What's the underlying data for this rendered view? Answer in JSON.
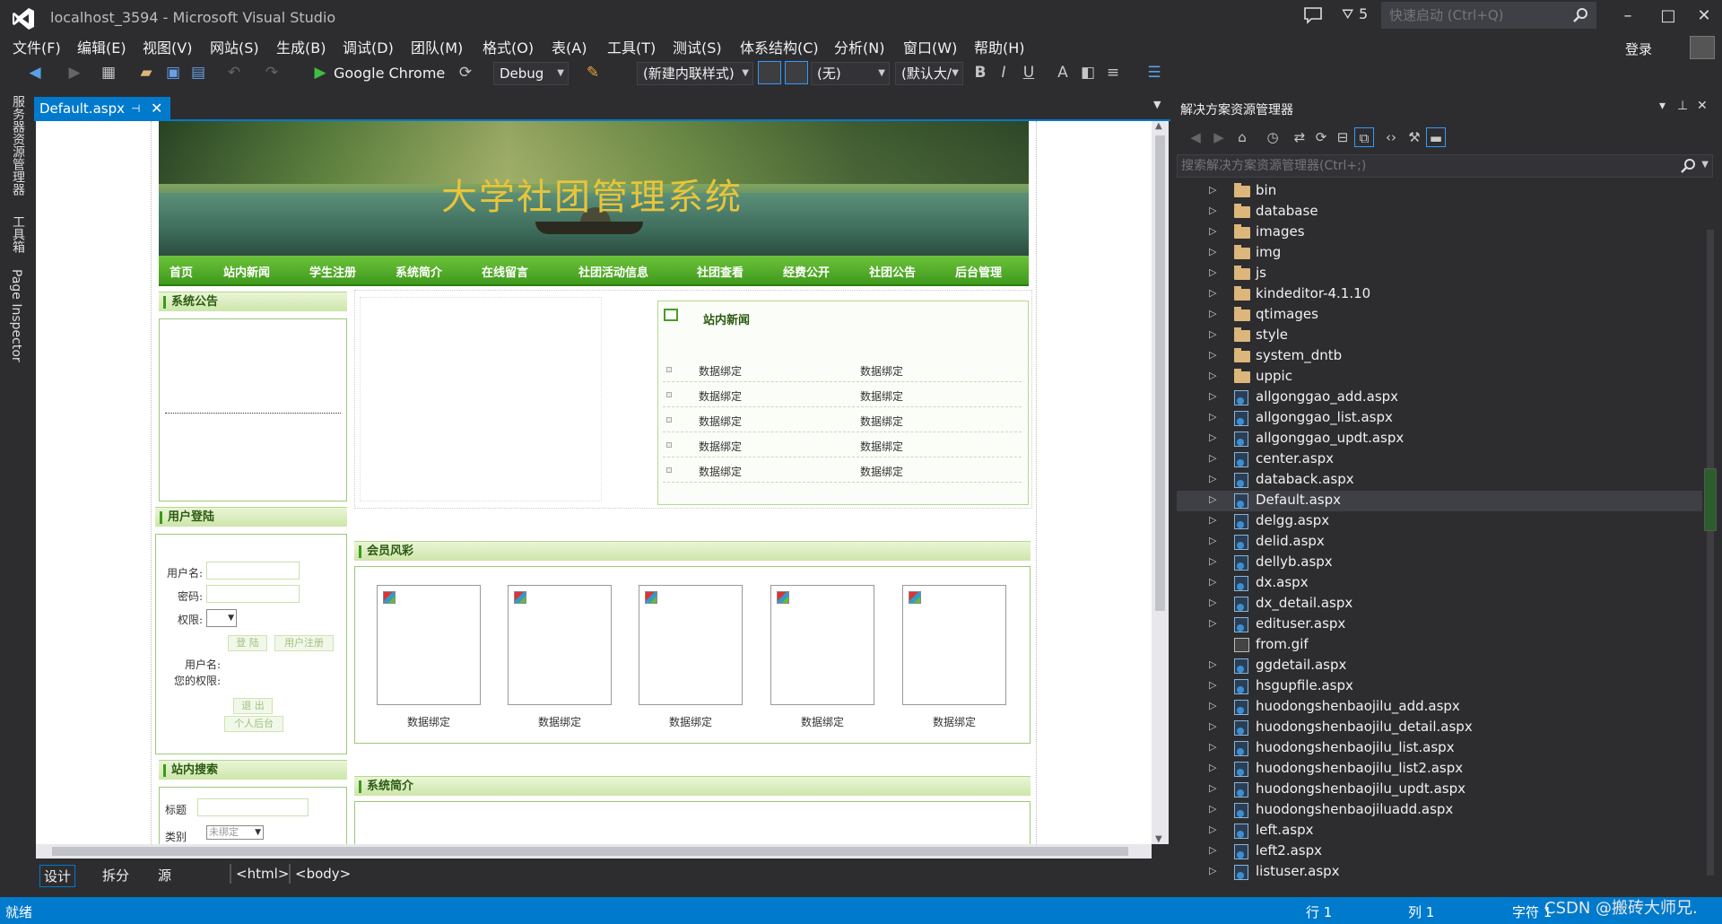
{
  "window": {
    "title": "localhost_3594 - Microsoft Visual Studio",
    "filter_count": "5",
    "quick_launch_placeholder": "快速启动 (Ctrl+Q)",
    "login": "登录"
  },
  "menu": [
    "文件(F)",
    "编辑(E)",
    "视图(V)",
    "网站(S)",
    "生成(B)",
    "调试(D)",
    "团队(M)",
    "格式(O)",
    "表(A)",
    "工具(T)",
    "测试(S)",
    "体系结构(C)",
    "分析(N)",
    "窗口(W)",
    "帮助(H)"
  ],
  "toolbar": {
    "browser": "Google Chrome",
    "config": "Debug",
    "style_combo": "(新建内联样式)",
    "target_combo": "(无)",
    "font_combo": "(默认大/"
  },
  "left_strip": [
    "服务器资源管理器",
    "工具箱",
    "Page Inspector"
  ],
  "document_tab": "Default.aspx",
  "designer": {
    "banner_title": "大学社团管理系统",
    "nav": [
      "首页",
      "站内新闻",
      "学生注册",
      "系统简介",
      "在线留言",
      "社团活动信息",
      "社团查看",
      "经费公开",
      "社团公告",
      "后台管理"
    ],
    "notice_title": "系统公告",
    "login_box": {
      "title": "用户登陆",
      "username_label": "用户名:",
      "password_label": "密码:",
      "role_label": "权限:",
      "login_btn": "登 陆",
      "register_btn": "用户注册",
      "user_label": "用户名:",
      "your_role_label": "您的权限:",
      "logout_btn": "退 出",
      "backend_btn": "个人后台"
    },
    "search_box": {
      "title": "站内搜索",
      "title_label": "标题",
      "type_label": "类别",
      "type_select": "未绑定"
    },
    "news": {
      "title": "站内新闻",
      "rows": [
        [
          "数据绑定",
          "数据绑定"
        ],
        [
          "数据绑定",
          "数据绑定"
        ],
        [
          "数据绑定",
          "数据绑定"
        ],
        [
          "数据绑定",
          "数据绑定"
        ],
        [
          "数据绑定",
          "数据绑定"
        ]
      ]
    },
    "members": {
      "title": "会员风彩",
      "captions": [
        "数据绑定",
        "数据绑定",
        "数据绑定",
        "数据绑定",
        "数据绑定"
      ]
    },
    "intro_title": "系统简介"
  },
  "design_tabs": [
    "设计",
    "拆分",
    "源"
  ],
  "breadcrumb": [
    "<html>",
    "<body>"
  ],
  "solution_explorer": {
    "title": "解决方案资源管理器",
    "search_placeholder": "搜索解决方案资源管理器(Ctrl+;)",
    "items": [
      {
        "name": "bin",
        "type": "folder"
      },
      {
        "name": "database",
        "type": "folder"
      },
      {
        "name": "images",
        "type": "folder"
      },
      {
        "name": "img",
        "type": "folder"
      },
      {
        "name": "js",
        "type": "folder"
      },
      {
        "name": "kindeditor-4.1.10",
        "type": "folder"
      },
      {
        "name": "qtimages",
        "type": "folder"
      },
      {
        "name": "style",
        "type": "folder"
      },
      {
        "name": "system_dntb",
        "type": "folder"
      },
      {
        "name": "uppic",
        "type": "folder"
      },
      {
        "name": "allgonggao_add.aspx",
        "type": "aspx"
      },
      {
        "name": "allgonggao_list.aspx",
        "type": "aspx"
      },
      {
        "name": "allgonggao_updt.aspx",
        "type": "aspx"
      },
      {
        "name": "center.aspx",
        "type": "aspx"
      },
      {
        "name": "databack.aspx",
        "type": "aspx"
      },
      {
        "name": "Default.aspx",
        "type": "aspx",
        "selected": true
      },
      {
        "name": "delgg.aspx",
        "type": "aspx"
      },
      {
        "name": "delid.aspx",
        "type": "aspx"
      },
      {
        "name": "dellyb.aspx",
        "type": "aspx"
      },
      {
        "name": "dx.aspx",
        "type": "aspx"
      },
      {
        "name": "dx_detail.aspx",
        "type": "aspx"
      },
      {
        "name": "edituser.aspx",
        "type": "aspx"
      },
      {
        "name": "from.gif",
        "type": "gif"
      },
      {
        "name": "ggdetail.aspx",
        "type": "aspx"
      },
      {
        "name": "hsgupfile.aspx",
        "type": "aspx"
      },
      {
        "name": "huodongshenbaojilu_add.aspx",
        "type": "aspx"
      },
      {
        "name": "huodongshenbaojilu_detail.aspx",
        "type": "aspx"
      },
      {
        "name": "huodongshenbaojilu_list.aspx",
        "type": "aspx"
      },
      {
        "name": "huodongshenbaojilu_list2.aspx",
        "type": "aspx"
      },
      {
        "name": "huodongshenbaojilu_updt.aspx",
        "type": "aspx"
      },
      {
        "name": "huodongshenbaojiluadd.aspx",
        "type": "aspx"
      },
      {
        "name": "left.aspx",
        "type": "aspx"
      },
      {
        "name": "left2.aspx",
        "type": "aspx"
      },
      {
        "name": "listuser.aspx",
        "type": "aspx"
      }
    ]
  },
  "status": {
    "ready": "就绪",
    "line": "行 1",
    "col": "列 1",
    "char": "字符 1",
    "watermark": "CSDN @搬砖大师兄."
  }
}
